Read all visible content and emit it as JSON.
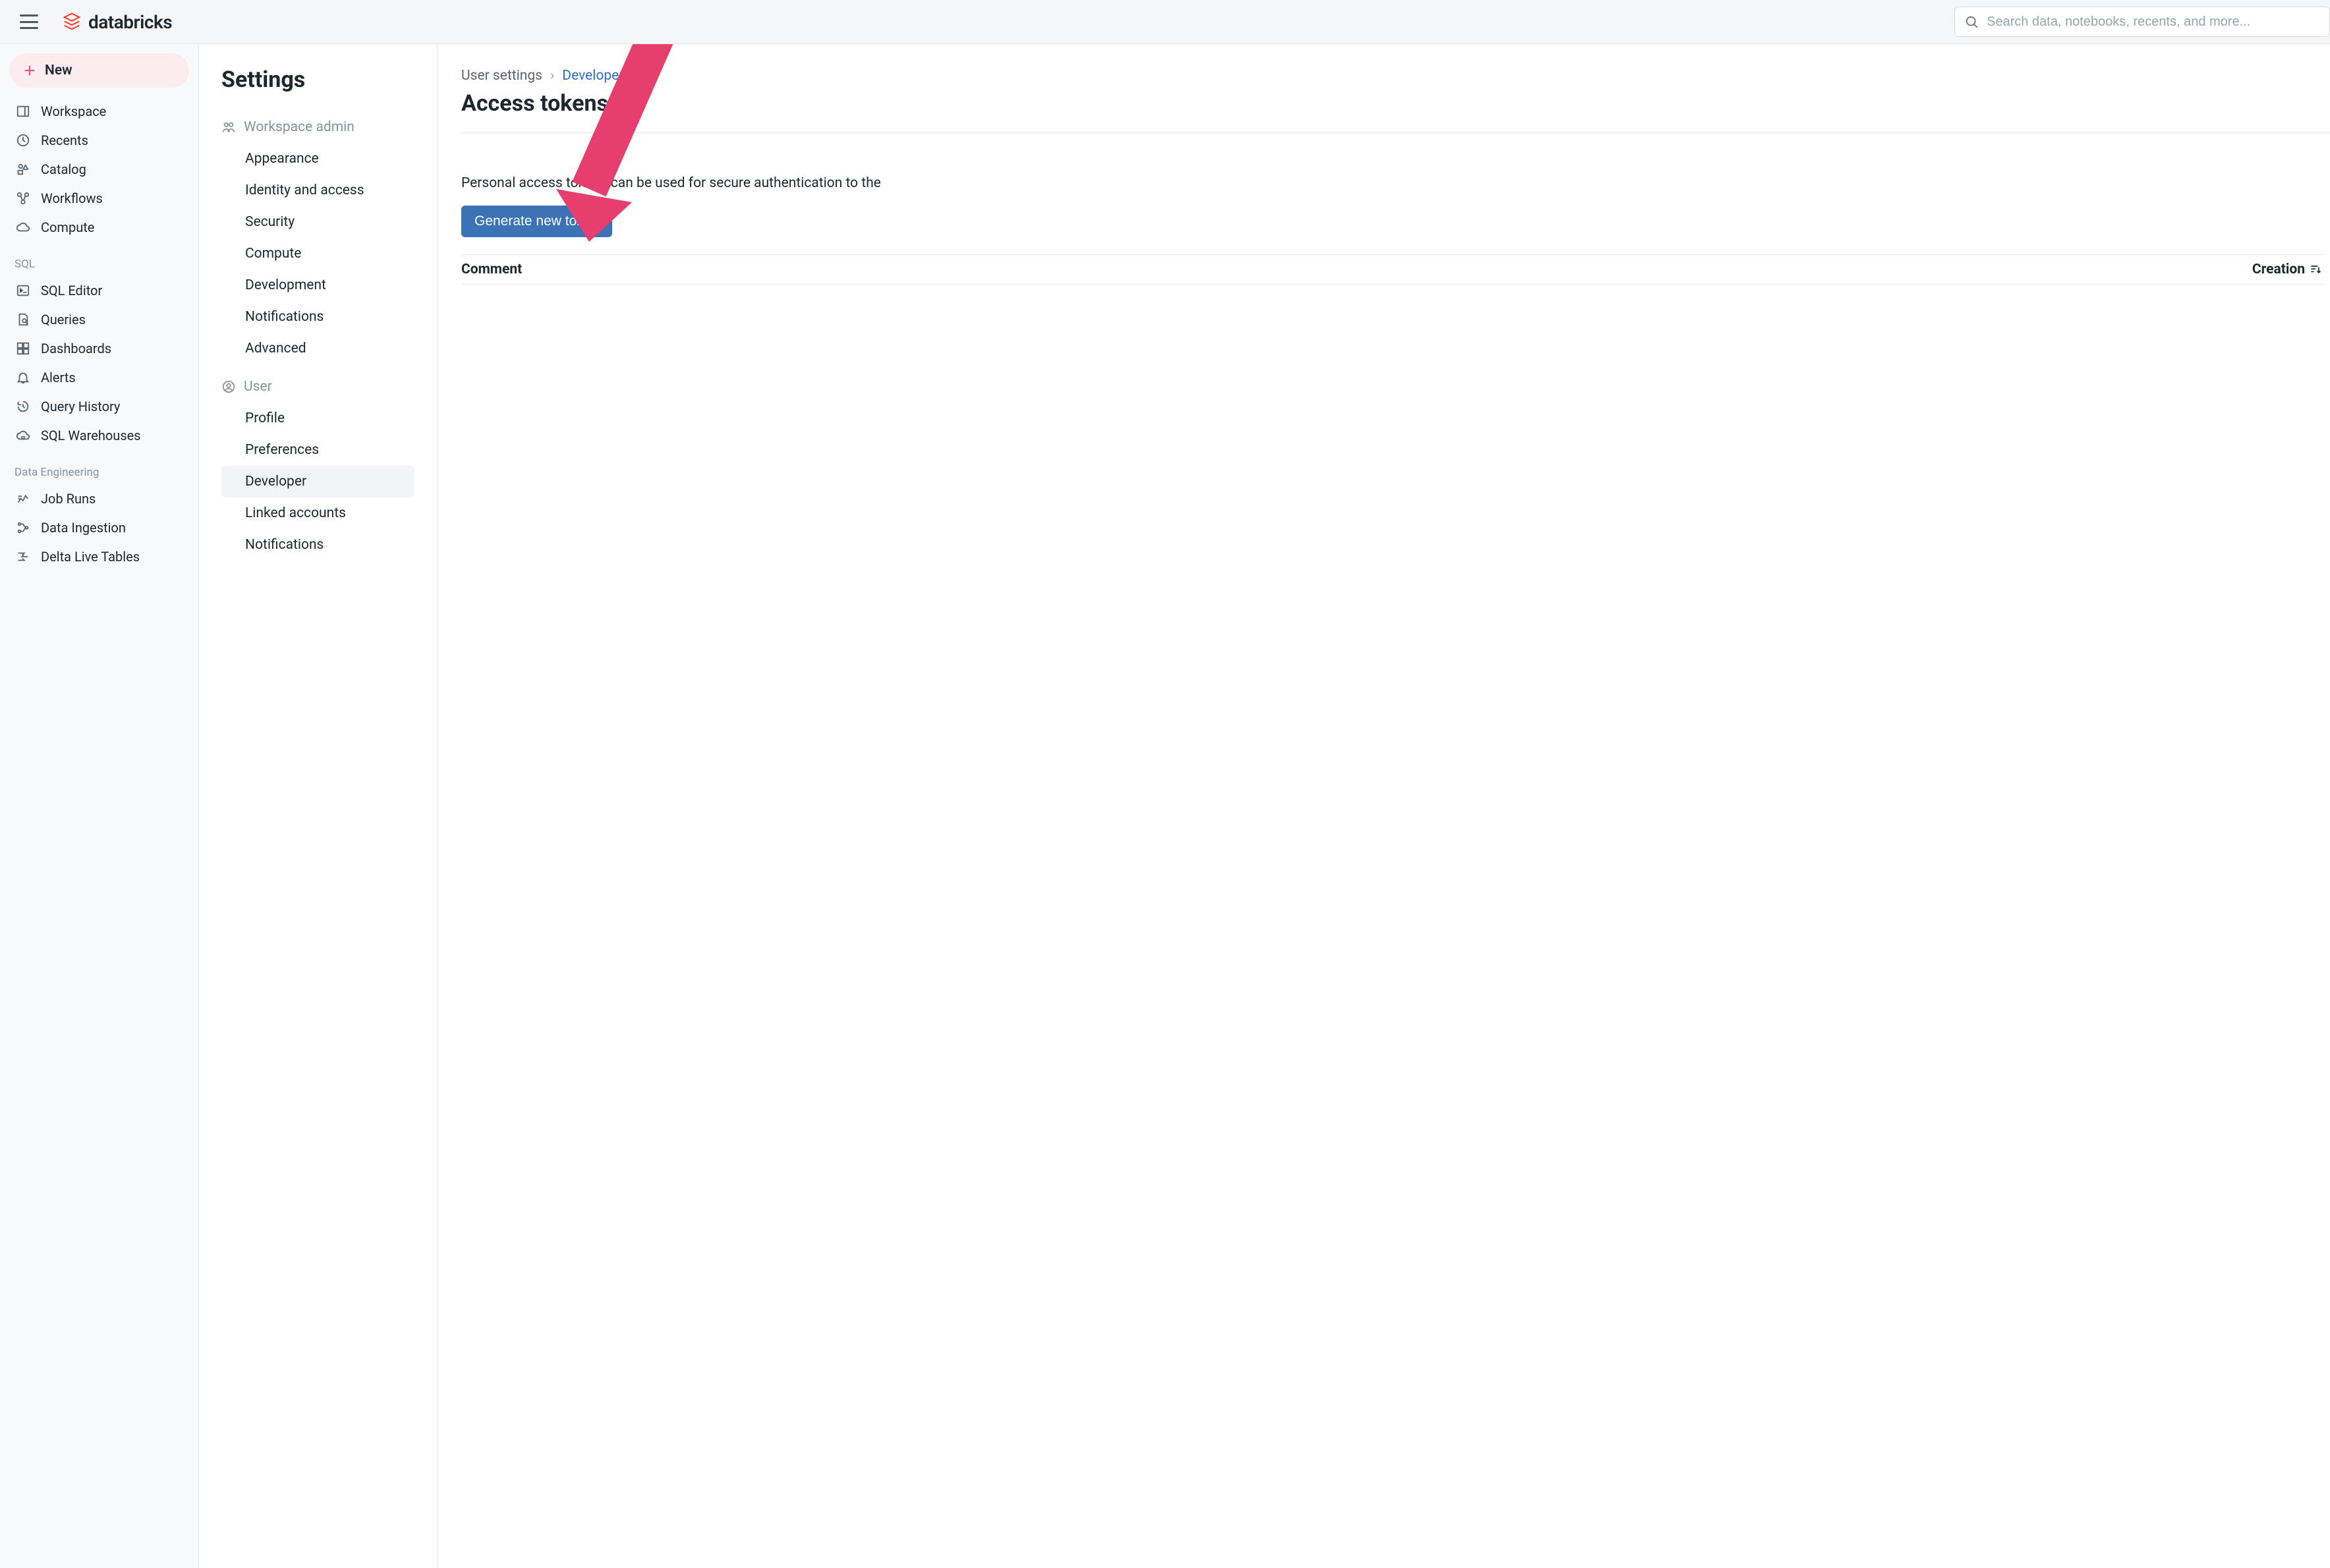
{
  "brand": "databricks",
  "search": {
    "placeholder": "Search data, notebooks, recents, and more..."
  },
  "sidebar": {
    "new_label": "New",
    "primary": [
      {
        "label": "Workspace",
        "icon": "workspace"
      },
      {
        "label": "Recents",
        "icon": "clock"
      },
      {
        "label": "Catalog",
        "icon": "catalog"
      },
      {
        "label": "Workflows",
        "icon": "workflow"
      },
      {
        "label": "Compute",
        "icon": "cloud"
      }
    ],
    "sql_header": "SQL",
    "sql": [
      {
        "label": "SQL Editor",
        "icon": "sql"
      },
      {
        "label": "Queries",
        "icon": "queries"
      },
      {
        "label": "Dashboards",
        "icon": "dashboard"
      },
      {
        "label": "Alerts",
        "icon": "bell"
      },
      {
        "label": "Query History",
        "icon": "history"
      },
      {
        "label": "SQL Warehouses",
        "icon": "warehouse"
      }
    ],
    "de_header": "Data Engineering",
    "de": [
      {
        "label": "Job Runs",
        "icon": "jobruns"
      },
      {
        "label": "Data Ingestion",
        "icon": "ingest"
      },
      {
        "label": "Delta Live Tables",
        "icon": "dlt"
      }
    ]
  },
  "settings": {
    "title": "Settings",
    "group1": {
      "header": "Workspace admin",
      "items": [
        "Appearance",
        "Identity and access",
        "Security",
        "Compute",
        "Development",
        "Notifications",
        "Advanced"
      ]
    },
    "group2": {
      "header": "User",
      "items": [
        "Profile",
        "Preferences",
        "Developer",
        "Linked accounts",
        "Notifications"
      ],
      "active_index": 2
    }
  },
  "page": {
    "crumbs": [
      "User settings",
      "Developer"
    ],
    "title": "Access tokens",
    "desc": "Personal access tokens can be used for secure authentication to the ",
    "button": "Generate new token",
    "columns": [
      "Comment",
      "Creation"
    ]
  }
}
